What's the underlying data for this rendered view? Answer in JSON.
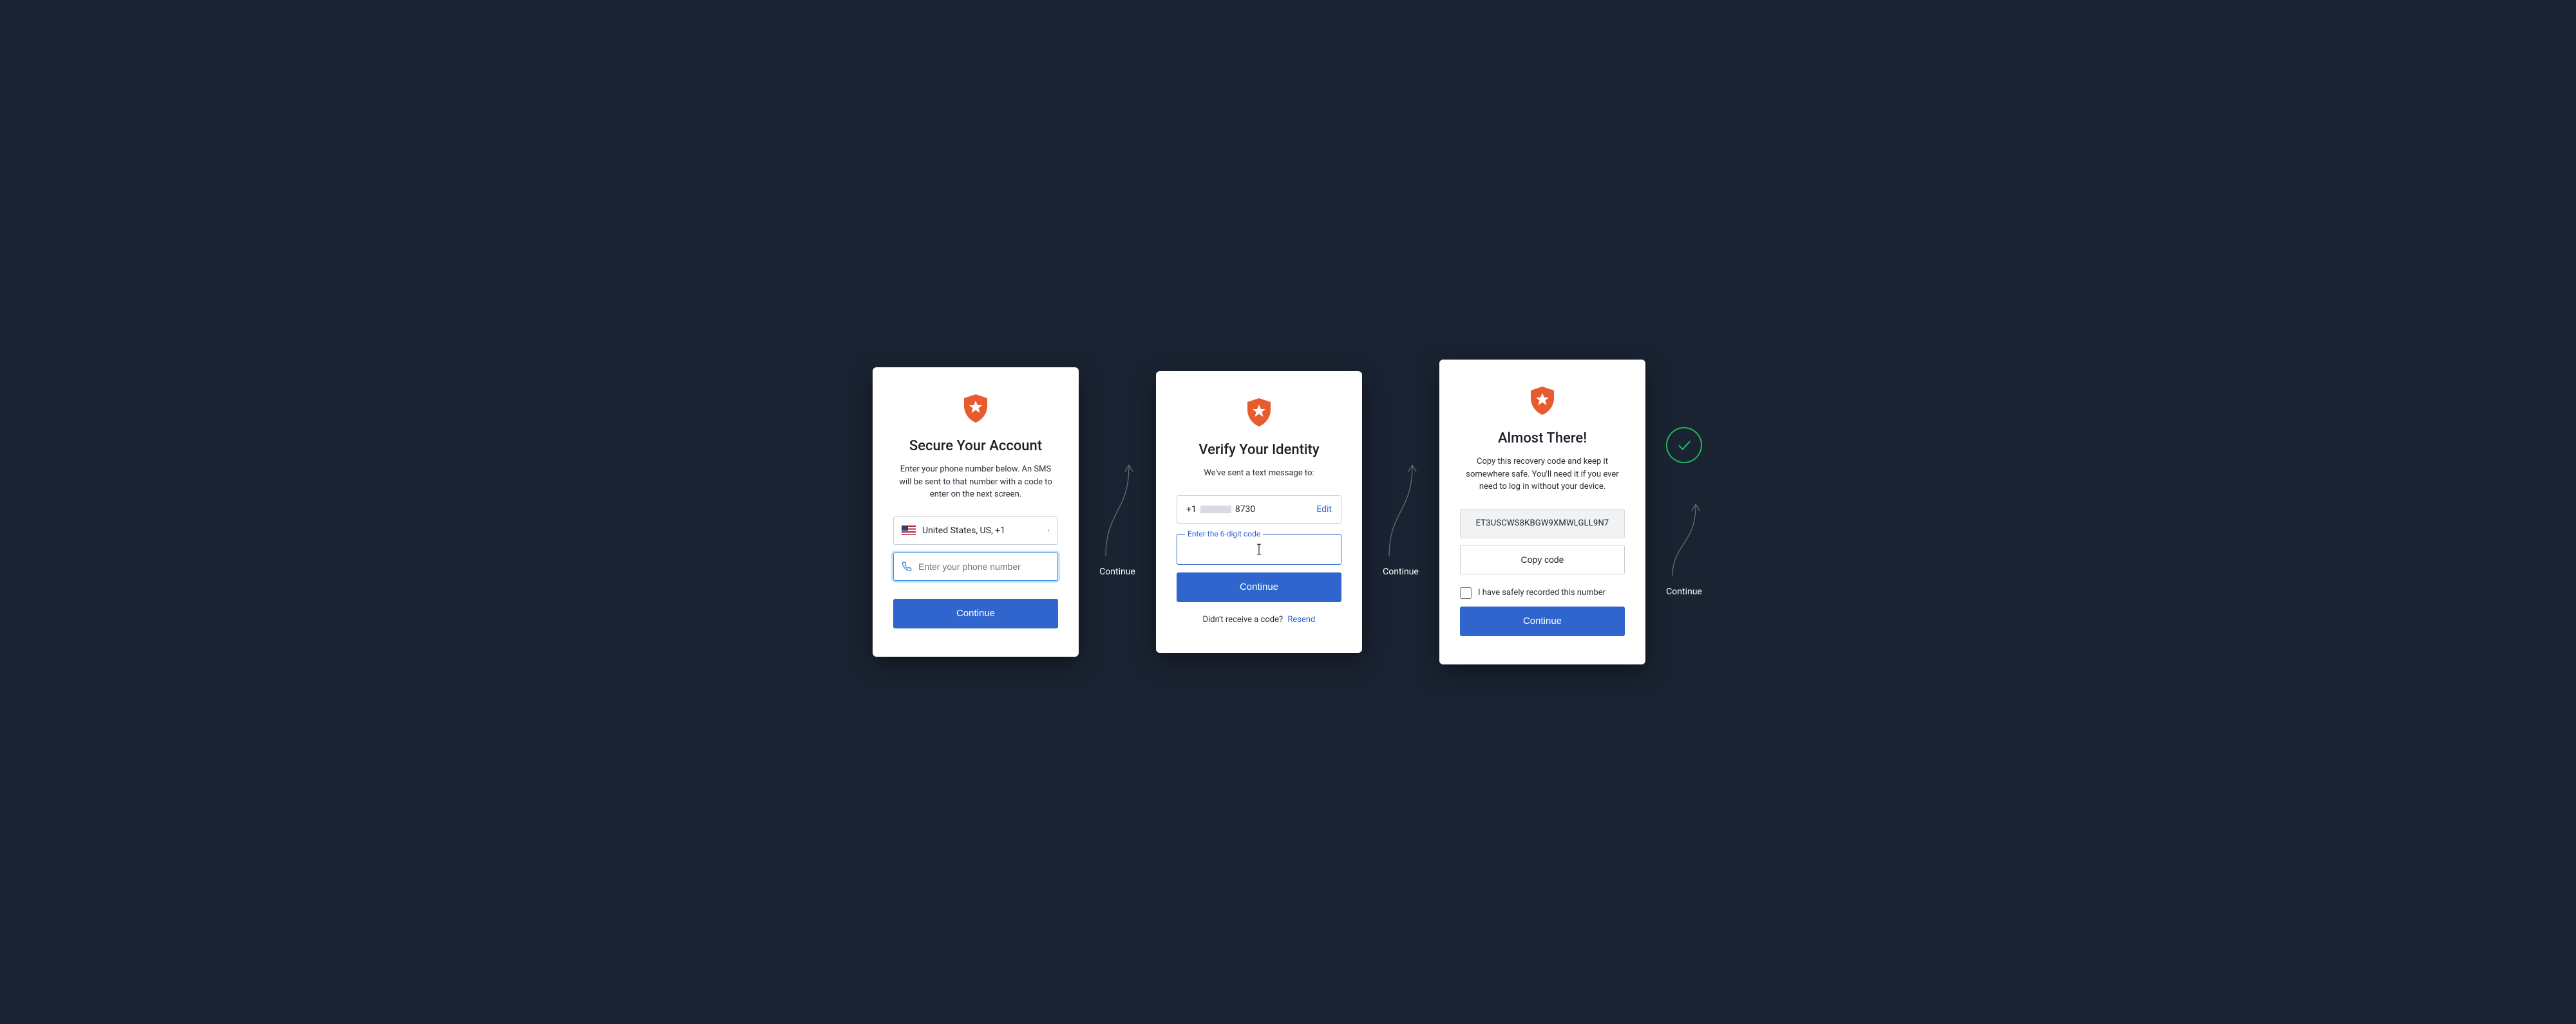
{
  "step1": {
    "title": "Secure Your Account",
    "subtitle": "Enter your phone number below. An SMS will be sent to that number with a code to enter on the next screen.",
    "country_label": "United States, US, +1",
    "phone_placeholder": "Enter your phone number",
    "button": "Continue"
  },
  "connector1": {
    "label": "Continue"
  },
  "step2": {
    "title": "Verify Your Identity",
    "subtitle": "We've sent a text message to:",
    "phone_prefix": "+1",
    "phone_suffix": "8730",
    "edit": "Edit",
    "code_label": "Enter the 6-digit code",
    "button": "Continue",
    "helper_text": "Didn't receive a code?",
    "resend": "Resend"
  },
  "connector2": {
    "label": "Continue"
  },
  "step3": {
    "title": "Almost There!",
    "subtitle": "Copy this recovery code and keep it somewhere safe. You'll need it if you ever need to log in without your device.",
    "recovery_code": "ET3USCWS8KBGW9XMWLGLL9N7",
    "copy_button": "Copy code",
    "checkbox_label": "I have safely recorded this number",
    "button": "Continue"
  },
  "connector3": {
    "label": "Continue"
  }
}
